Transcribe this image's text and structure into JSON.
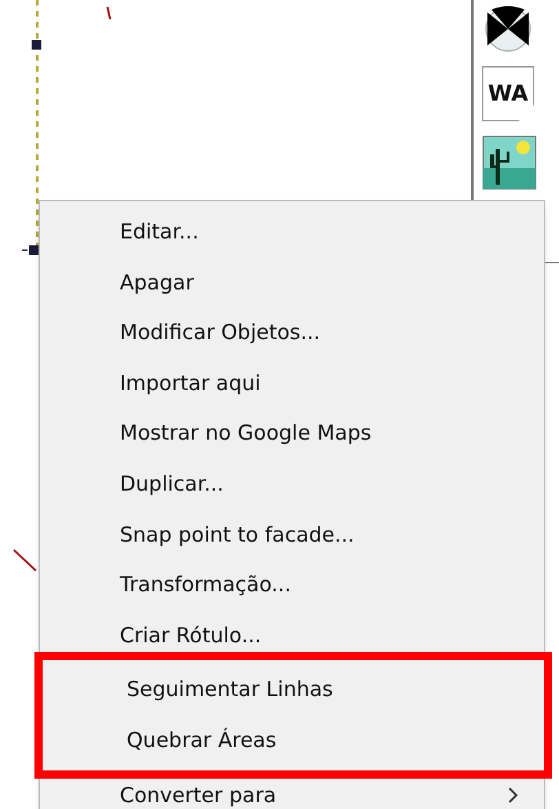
{
  "toolbar": {
    "tool_label": "WA"
  },
  "context_menu": {
    "items": [
      {
        "label": "Editar...",
        "has_submenu": false,
        "boxed": false
      },
      {
        "label": "Apagar",
        "has_submenu": false,
        "boxed": false
      },
      {
        "label": "Modificar Objetos...",
        "has_submenu": false,
        "boxed": false
      },
      {
        "label": "Importar aqui",
        "has_submenu": false,
        "boxed": false
      },
      {
        "label": "Mostrar no Google Maps",
        "has_submenu": false,
        "boxed": false
      },
      {
        "label": "Duplicar...",
        "has_submenu": false,
        "boxed": false
      },
      {
        "label": "Snap point to facade...",
        "has_submenu": false,
        "boxed": false
      },
      {
        "label": "Transformação...",
        "has_submenu": false,
        "boxed": false
      },
      {
        "label": "Criar Rótulo...",
        "has_submenu": false,
        "boxed": false
      },
      {
        "label": "Seguimentar Linhas",
        "has_submenu": false,
        "boxed": true
      },
      {
        "label": "Quebrar Áreas",
        "has_submenu": false,
        "boxed": true
      },
      {
        "label": "Converter para",
        "has_submenu": true,
        "boxed": false
      }
    ]
  }
}
